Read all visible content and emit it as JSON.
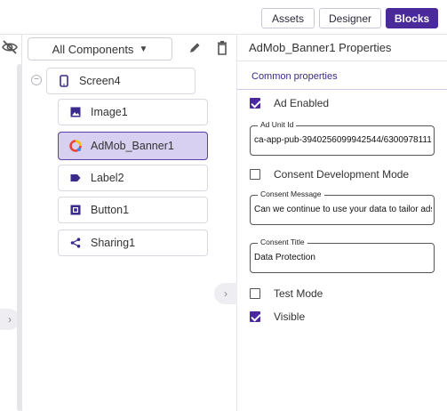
{
  "toolbar": {
    "assets_label": "Assets",
    "designer_label": "Designer",
    "blocks_label": "Blocks"
  },
  "tree": {
    "dropdown_label": "All Components",
    "nodes": [
      {
        "label": "Screen4",
        "icon": "phone-icon"
      },
      {
        "label": "Image1",
        "icon": "image-icon"
      },
      {
        "label": "AdMob_Banner1",
        "icon": "admob-icon",
        "selected": true
      },
      {
        "label": "Label2",
        "icon": "label-icon"
      },
      {
        "label": "Button1",
        "icon": "button-icon"
      },
      {
        "label": "Sharing1",
        "icon": "share-icon"
      }
    ]
  },
  "properties": {
    "title": "AdMob_Banner1 Properties",
    "section": "Common properties",
    "ad_enabled": {
      "label": "Ad Enabled",
      "checked": true
    },
    "ad_unit_id": {
      "label": "Ad Unit Id",
      "value": "ca-app-pub-3940256099942544/6300978111"
    },
    "consent_dev_mode": {
      "label": "Consent Development Mode",
      "checked": false
    },
    "consent_message": {
      "label": "Consent Message",
      "value": "Can we continue to use your data to tailor ads for you?"
    },
    "consent_title": {
      "label": "Consent Title",
      "value": "Data Protection"
    },
    "test_mode": {
      "label": "Test Mode",
      "checked": false
    },
    "visible": {
      "label": "Visible",
      "checked": true
    }
  },
  "colors": {
    "accent": "#4a2a9a",
    "selected_bg": "#d8d0f0"
  }
}
